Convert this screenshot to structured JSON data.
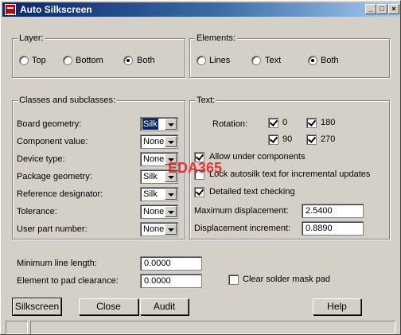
{
  "window": {
    "title": "Auto Silkscreen"
  },
  "layer": {
    "label": "Layer:",
    "options": [
      "Top",
      "Bottom",
      "Both"
    ],
    "selected": "Both"
  },
  "elements": {
    "label": "Elements:",
    "options": [
      "Lines",
      "Text",
      "Both"
    ],
    "selected": "Both"
  },
  "classes": {
    "label": "Classes and subclasses:",
    "rows": [
      {
        "label": "Board geometry:",
        "value": "Silk"
      },
      {
        "label": "Component value:",
        "value": "None"
      },
      {
        "label": "Device type:",
        "value": "None"
      },
      {
        "label": "Package geometry:",
        "value": "Silk"
      },
      {
        "label": "Reference designator:",
        "value": "Silk"
      },
      {
        "label": "Tolerance:",
        "value": "None"
      },
      {
        "label": "User part number:",
        "value": "None"
      }
    ]
  },
  "text": {
    "label": "Text:",
    "rotation_label": "Rotation:",
    "rotations": [
      {
        "label": "0",
        "checked": true
      },
      {
        "label": "180",
        "checked": true
      },
      {
        "label": "90",
        "checked": true
      },
      {
        "label": "270",
        "checked": true
      }
    ],
    "allow_under_components": {
      "label": "Allow under components",
      "checked": true
    },
    "lock_autosilk": {
      "label": "Lock autosilk text for incremental updates",
      "checked": false
    },
    "detailed_checking": {
      "label": "Detailed text checking",
      "checked": true
    },
    "max_displacement": {
      "label": "Maximum displacement:",
      "value": "2.5400"
    },
    "displacement_increment": {
      "label": "Displacement increment:",
      "value": "0.8890"
    }
  },
  "bottom": {
    "min_line_length": {
      "label": "Minimum line length:",
      "value": "0.0000"
    },
    "element_to_pad": {
      "label": "Element to pad clearance:",
      "value": "0.0000"
    },
    "clear_solder_mask": {
      "label": "Clear solder mask pad",
      "checked": false
    }
  },
  "buttons": {
    "silkscreen": "Silkscreen",
    "close": "Close",
    "audit": "Audit",
    "help": "Help"
  },
  "watermark": "EDA365"
}
